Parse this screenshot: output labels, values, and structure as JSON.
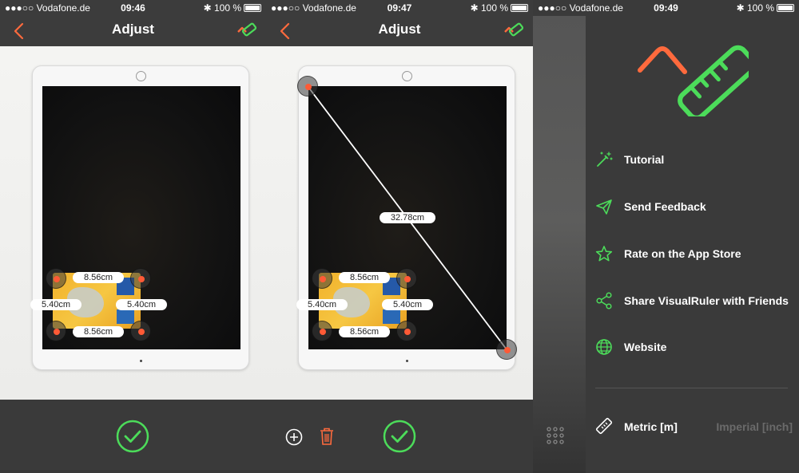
{
  "status": {
    "carrier": "●●●○○ Vodafone.de",
    "battery": "100 %",
    "times": [
      "09:46",
      "09:47",
      "09:49"
    ]
  },
  "adjust1": {
    "title": "Adjust",
    "labels": {
      "top": "8.56cm",
      "bottom": "8.56cm",
      "left": "5.40cm",
      "right": "5.40cm"
    }
  },
  "adjust2": {
    "title": "Adjust",
    "labels": {
      "top": "8.56cm",
      "bottom": "8.56cm",
      "left": "5.40cm",
      "right": "5.40cm",
      "diagonal": "32.78cm"
    }
  },
  "menu": {
    "items": [
      {
        "label": "Tutorial",
        "icon": "magic-wand-icon"
      },
      {
        "label": "Send Feedback",
        "icon": "paper-plane-icon"
      },
      {
        "label": "Rate on the App Store",
        "icon": "star-icon"
      },
      {
        "label": "Share VisualRuler with Friends",
        "icon": "share-icon"
      },
      {
        "label": "Website",
        "icon": "globe-icon"
      }
    ],
    "units": {
      "metric": "Metric [m]",
      "imperial": "Imperial [inch]"
    }
  },
  "colors": {
    "accent_orange": "#ff6a3d",
    "accent_green": "#4cdc5a",
    "bar_bg": "#3c3c3c"
  }
}
